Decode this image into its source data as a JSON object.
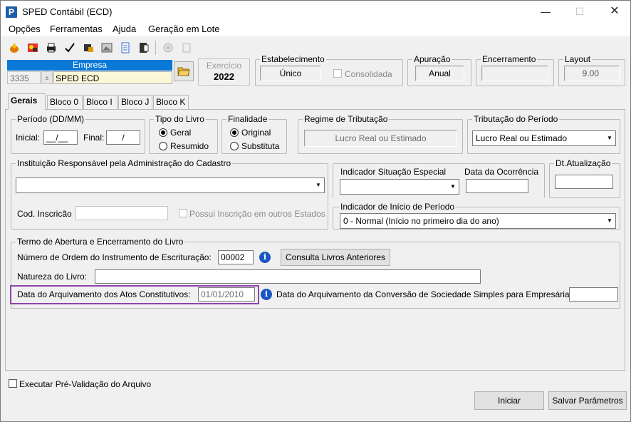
{
  "window": {
    "title": "SPED Contábil (ECD)",
    "icon_letter": "P",
    "minimize": "—",
    "maximize": "☐",
    "close": "✕"
  },
  "menu": [
    "Opções",
    "Ferramentas",
    "Ajuda",
    "Geração em Lote"
  ],
  "toolbar_icons": [
    "fire-icon",
    "people-icon",
    "printer-icon",
    "checkmark-icon",
    "database-icon",
    "image-icon",
    "list-icon",
    "document-icon",
    "disk-icon",
    "copy-icon"
  ],
  "empresa": {
    "header": "Empresa",
    "code": "3335",
    "name": "SPED ECD"
  },
  "exercicio": {
    "label": "Exercício",
    "value": "2022"
  },
  "estabelecimento": {
    "label": "Estabelecimento",
    "value": "Único",
    "consolidada_label": "Consolidada"
  },
  "apuracao": {
    "label": "Apuração",
    "value": "Anual"
  },
  "encerramento": {
    "label": "Encerramento",
    "value": ""
  },
  "layout": {
    "label": "Layout",
    "value": "9.00"
  },
  "tabs": [
    "Gerais",
    "Bloco 0",
    "Bloco I",
    "Bloco J",
    "Bloco K"
  ],
  "periodo": {
    "label": "Período (DD/MM)",
    "inicial_label": "Inicial:",
    "inicial_value": "__/__",
    "final_label": "Final:",
    "final_value": "/"
  },
  "tipo_livro": {
    "label": "Tipo do Livro",
    "opt1": "Geral",
    "opt2": "Resumido"
  },
  "finalidade": {
    "label": "Finalidade",
    "opt1": "Original",
    "opt2": "Substituta"
  },
  "regime": {
    "label": "Regime de Tributação",
    "value": "Lucro Real ou Estimado"
  },
  "tributacao": {
    "label": "Tributação do Período",
    "value": "Lucro Real ou Estimado"
  },
  "instituicao": {
    "label": "Instituição Responsável pela Administração do Cadastro",
    "value": "",
    "cod_label": "Cod. Inscricão",
    "cod_value": "",
    "possui_label": "Possui Inscrição em outros Estados"
  },
  "situacao": {
    "label": "Indicador Situação Especial",
    "value": "",
    "data_label": "Data da Ocorrência",
    "data_value": ""
  },
  "dt_atualizacao": {
    "label": "Dt.Atualização",
    "value": ""
  },
  "inicio_periodo": {
    "label": "Indicador de Início de Período",
    "value": "0 - Normal (Início no primeiro dia do ano)"
  },
  "termo": {
    "label": "Termo de Abertura e Encerramento do Livro",
    "ordem_label": "Número de Ordem do Instrumento de Escrituração:",
    "ordem_value": "00002",
    "consulta_button": "Consulta Livros Anteriores",
    "natureza_label": "Natureza do Livro:",
    "natureza_value": "",
    "arquivamento_label": "Data do Arquivamento dos Atos Constitutivos:",
    "arquivamento_value": "01/01/2010",
    "conversao_label": "Data do Arquivamento da Conversão de Sociedade Simples para Empresária:",
    "conversao_value": ""
  },
  "prevalidacao_label": "Executar Pré-Validação do Arquivo",
  "buttons": {
    "iniciar": "Iniciar",
    "salvar": "Salvar Parâmetros"
  },
  "highlight_color": "#8e44ad"
}
